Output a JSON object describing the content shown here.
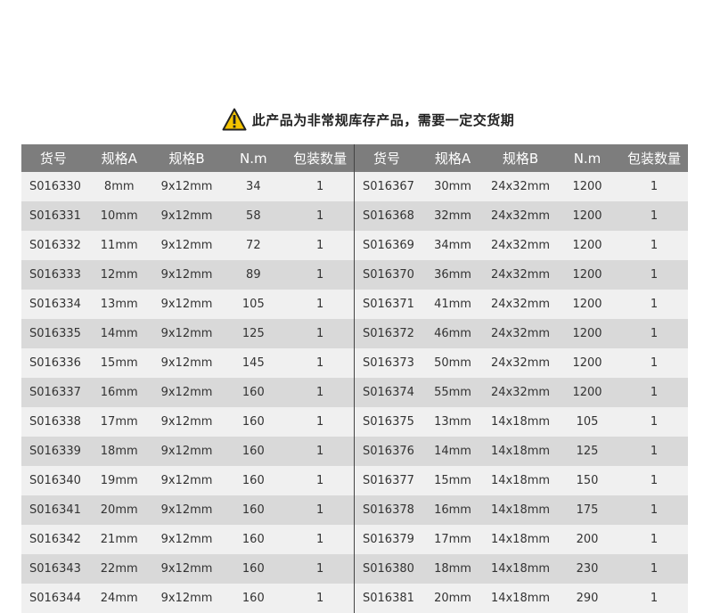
{
  "notice": {
    "icon": "warning-triangle-icon",
    "text": "此产品为非常规库存产品，需要一定交货期",
    "icon_color": "#f5c400"
  },
  "table": {
    "header_bg": "#7d7d7d",
    "left_headers": [
      "货号",
      "规格A",
      "规格B",
      "N.m",
      "包装数量"
    ],
    "right_headers": [
      "货号",
      "规格A",
      "规格B",
      "N.m",
      "包装数量"
    ],
    "left_rows": [
      [
        "S016330",
        "8mm",
        "9x12mm",
        "34",
        "1"
      ],
      [
        "S016331",
        "10mm",
        "9x12mm",
        "58",
        "1"
      ],
      [
        "S016332",
        "11mm",
        "9x12mm",
        "72",
        "1"
      ],
      [
        "S016333",
        "12mm",
        "9x12mm",
        "89",
        "1"
      ],
      [
        "S016334",
        "13mm",
        "9x12mm",
        "105",
        "1"
      ],
      [
        "S016335",
        "14mm",
        "9x12mm",
        "125",
        "1"
      ],
      [
        "S016336",
        "15mm",
        "9x12mm",
        "145",
        "1"
      ],
      [
        "S016337",
        "16mm",
        "9x12mm",
        "160",
        "1"
      ],
      [
        "S016338",
        "17mm",
        "9x12mm",
        "160",
        "1"
      ],
      [
        "S016339",
        "18mm",
        "9x12mm",
        "160",
        "1"
      ],
      [
        "S016340",
        "19mm",
        "9x12mm",
        "160",
        "1"
      ],
      [
        "S016341",
        "20mm",
        "9x12mm",
        "160",
        "1"
      ],
      [
        "S016342",
        "21mm",
        "9x12mm",
        "160",
        "1"
      ],
      [
        "S016343",
        "22mm",
        "9x12mm",
        "160",
        "1"
      ],
      [
        "S016344",
        "24mm",
        "9x12mm",
        "160",
        "1"
      ]
    ],
    "right_rows": [
      [
        "S016367",
        "30mm",
        "24x32mm",
        "1200",
        "1"
      ],
      [
        "S016368",
        "32mm",
        "24x32mm",
        "1200",
        "1"
      ],
      [
        "S016369",
        "34mm",
        "24x32mm",
        "1200",
        "1"
      ],
      [
        "S016370",
        "36mm",
        "24x32mm",
        "1200",
        "1"
      ],
      [
        "S016371",
        "41mm",
        "24x32mm",
        "1200",
        "1"
      ],
      [
        "S016372",
        "46mm",
        "24x32mm",
        "1200",
        "1"
      ],
      [
        "S016373",
        "50mm",
        "24x32mm",
        "1200",
        "1"
      ],
      [
        "S016374",
        "55mm",
        "24x32mm",
        "1200",
        "1"
      ],
      [
        "S016375",
        "13mm",
        "14x18mm",
        "105",
        "1"
      ],
      [
        "S016376",
        "14mm",
        "14x18mm",
        "125",
        "1"
      ],
      [
        "S016377",
        "15mm",
        "14x18mm",
        "150",
        "1"
      ],
      [
        "S016378",
        "16mm",
        "14x18mm",
        "175",
        "1"
      ],
      [
        "S016379",
        "17mm",
        "14x18mm",
        "200",
        "1"
      ],
      [
        "S016380",
        "18mm",
        "14x18mm",
        "230",
        "1"
      ],
      [
        "S016381",
        "20mm",
        "14x18mm",
        "290",
        "1"
      ]
    ]
  }
}
